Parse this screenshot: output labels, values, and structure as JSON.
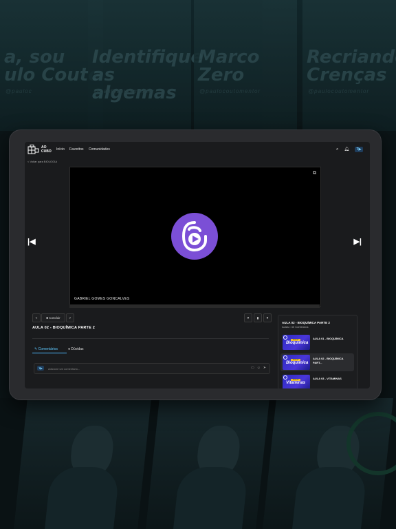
{
  "background": {
    "posters": [
      {
        "title": "a, sou\nulo Couto",
        "handle": "@pauloc"
      },
      {
        "title": "Identifique\nas algemas",
        "handle": "@paulocoutomentor"
      },
      {
        "title": "Marco\nZero",
        "handle": "@paulocoutomentor"
      },
      {
        "title": "Recriando\nCrenças",
        "handle": "@paulocoutomentor"
      }
    ]
  },
  "nav": {
    "logo_line1": "AO",
    "logo_line2": "CUBO",
    "links": [
      "Início",
      "Favoritos",
      "Comunidades"
    ],
    "avatar": "T▶"
  },
  "back_link": "< Voltar para BIOLOGIA",
  "player": {
    "author": "GABRIEL GOMES GONCALVES",
    "accent": "#7b4fd6"
  },
  "controls": {
    "prev": "<",
    "concluir": "Concluir",
    "next": ">"
  },
  "lesson": {
    "title": "AULA 02 - BIOQUÍMICA PARTE 2"
  },
  "tabs": {
    "comments": "Comentários",
    "doubts": "Dúvidas"
  },
  "comment": {
    "placeholder": "Adicione um comentário..."
  },
  "playlist": {
    "title": "AULA 02 - BIOQUÍMICA PARTE 2",
    "subtitle": "Aulas • 40 Conteúdos",
    "items": [
      {
        "label": "AULA 01 - BIOQUÍMICA",
        "thumb_tag": "Aula 01",
        "thumb_subject": "Bioquímica"
      },
      {
        "label": "AULA 02 - BIOQUÍMICA PART...",
        "thumb_tag": "Aula 02",
        "thumb_subject": "Bioquímica"
      },
      {
        "label": "AULA 03 - VITAMINAS",
        "thumb_tag": "Aula 03",
        "thumb_subject": "Vitaminas"
      }
    ]
  }
}
